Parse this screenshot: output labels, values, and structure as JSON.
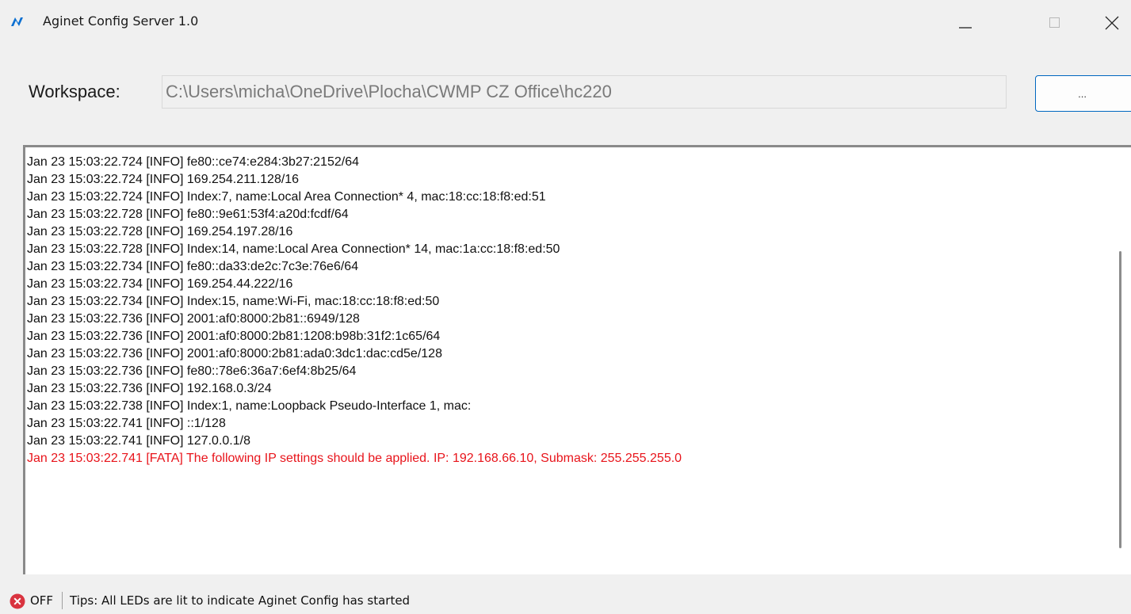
{
  "window": {
    "title": "Aginet Config Server 1.0",
    "icon": "aginet-logo-icon",
    "accent_color": "#0a6fd1"
  },
  "workspace": {
    "label": "Workspace:",
    "path": "C:\\Users\\micha\\OneDrive\\Plocha\\CWMP CZ Office\\hc220",
    "browse_label": "..."
  },
  "log": {
    "lines": [
      "Jan 23 15:03:22.724 [INFO] fe80::ce74:e284:3b27:2152/64",
      "Jan 23 15:03:22.724 [INFO] 169.254.211.128/16",
      "Jan 23 15:03:22.724 [INFO] Index:7, name:Local Area Connection* 4, mac:18:cc:18:f8:ed:51",
      "Jan 23 15:03:22.728 [INFO] fe80::9e61:53f4:a20d:fcdf/64",
      "Jan 23 15:03:22.728 [INFO] 169.254.197.28/16",
      "Jan 23 15:03:22.728 [INFO] Index:14, name:Local Area Connection* 14, mac:1a:cc:18:f8:ed:50",
      "Jan 23 15:03:22.734 [INFO] fe80::da33:de2c:7c3e:76e6/64",
      "Jan 23 15:03:22.734 [INFO] 169.254.44.222/16",
      "Jan 23 15:03:22.734 [INFO] Index:15, name:Wi-Fi, mac:18:cc:18:f8:ed:50",
      "Jan 23 15:03:22.736 [INFO] 2001:af0:8000:2b81::6949/128",
      "Jan 23 15:03:22.736 [INFO] 2001:af0:8000:2b81:1208:b98b:31f2:1c65/64",
      "Jan 23 15:03:22.736 [INFO] 2001:af0:8000:2b81:ada0:3dc1:dac:cd5e/128",
      "Jan 23 15:03:22.736 [INFO] fe80::78e6:36a7:6ef4:8b25/64",
      "Jan 23 15:03:22.736 [INFO] 192.168.0.3/24",
      "Jan 23 15:03:22.738 [INFO] Index:1, name:Loopback Pseudo-Interface 1, mac:",
      "Jan 23 15:03:22.741 [INFO] ::1/128",
      "Jan 23 15:03:22.741 [INFO] 127.0.0.1/8"
    ],
    "fatal_line": "Jan 23 15:03:22.741 [FATA] The following IP settings should be applied. IP: 192.168.66.10, Submask: 255.255.255.0",
    "fatal_color": "#e8141b"
  },
  "status": {
    "state": "OFF",
    "state_icon": "error-x-circle-icon",
    "state_color": "#d9333f",
    "tips": "Tips: All LEDs are lit to indicate Aginet Config has started"
  }
}
